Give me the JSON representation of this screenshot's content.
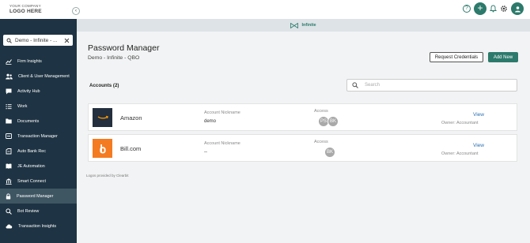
{
  "header": {
    "logo_line1": "YOUR COMPANY",
    "logo_line2": "LOGO HERE",
    "help_icon": "question-circle-icon",
    "add_icon": "plus-icon",
    "bell_icon": "bell-icon",
    "settings_icon": "gear-icon",
    "user_icon": "user-icon",
    "accent_color": "#2c7a6b"
  },
  "sidebar": {
    "search_value": "Demo - Infinite - ...",
    "bg_color": "#1e3343",
    "items": [
      {
        "label": "Firm Insights",
        "icon": "chart-icon"
      },
      {
        "label": "Client & User Management",
        "icon": "users-icon"
      },
      {
        "label": "Activity Hub",
        "icon": "chat-icon"
      },
      {
        "label": "Work",
        "icon": "list-icon"
      },
      {
        "label": "Documents",
        "icon": "folder-icon"
      },
      {
        "label": "Transaction Manager",
        "icon": "transaction-icon"
      },
      {
        "label": "Auto Bank Rec",
        "icon": "bank-rec-icon"
      },
      {
        "label": "JE Automation",
        "icon": "book-icon"
      },
      {
        "label": "Smart Connect",
        "icon": "bank-icon"
      },
      {
        "label": "Password Manager",
        "icon": "lock-icon",
        "active": true
      },
      {
        "label": "Bot Review",
        "icon": "search-bot-icon"
      },
      {
        "label": "Transaction Insights",
        "icon": "insights-icon"
      }
    ]
  },
  "subbar": {
    "label": "Infinite",
    "icon": "bowtie-icon"
  },
  "main": {
    "title": "Password Manager",
    "subtitle": "Demo - Infinite - QBO",
    "request_button": "Request Credentials",
    "add_button": "Add New",
    "accounts_label": "Accounts (2)",
    "search_placeholder": "Search",
    "footnote": "Logos provided by Clearbit"
  },
  "accounts": [
    {
      "name": "Amazon",
      "logo_icon": "amazon-logo-icon",
      "nickname_label": "Account Nickname",
      "nickname": "demo",
      "access_label": "Access",
      "access_users": [
        "PS",
        "BK"
      ],
      "view_label": "View",
      "owner": "Owner: Accountant"
    },
    {
      "name": "Bill.com",
      "logo_icon": "billcom-logo-icon",
      "nickname_label": "Account Nickname",
      "nickname": "--",
      "access_label": "Access",
      "access_users": [
        "BK"
      ],
      "view_label": "View",
      "owner": "Owner: Accountant"
    }
  ]
}
